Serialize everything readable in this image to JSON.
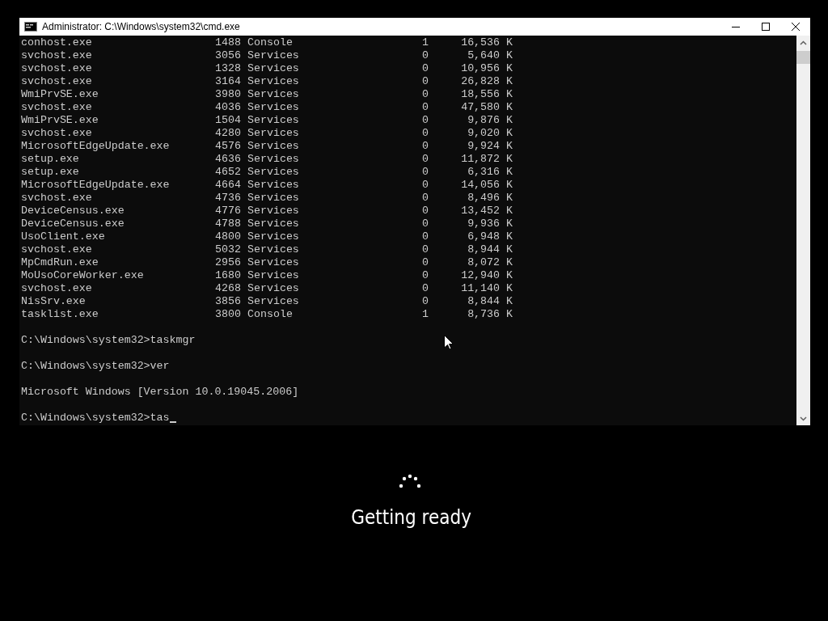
{
  "window": {
    "title": "Administrator: C:\\Windows\\system32\\cmd.exe"
  },
  "processes": [
    {
      "name": "conhost.exe",
      "pid": "1488",
      "session_name": "Console",
      "session": "1",
      "mem": "16,536 K"
    },
    {
      "name": "svchost.exe",
      "pid": "3056",
      "session_name": "Services",
      "session": "0",
      "mem": "5,640 K"
    },
    {
      "name": "svchost.exe",
      "pid": "1328",
      "session_name": "Services",
      "session": "0",
      "mem": "10,956 K"
    },
    {
      "name": "svchost.exe",
      "pid": "3164",
      "session_name": "Services",
      "session": "0",
      "mem": "26,828 K"
    },
    {
      "name": "WmiPrvSE.exe",
      "pid": "3980",
      "session_name": "Services",
      "session": "0",
      "mem": "18,556 K"
    },
    {
      "name": "svchost.exe",
      "pid": "4036",
      "session_name": "Services",
      "session": "0",
      "mem": "47,580 K"
    },
    {
      "name": "WmiPrvSE.exe",
      "pid": "1504",
      "session_name": "Services",
      "session": "0",
      "mem": "9,876 K"
    },
    {
      "name": "svchost.exe",
      "pid": "4280",
      "session_name": "Services",
      "session": "0",
      "mem": "9,020 K"
    },
    {
      "name": "MicrosoftEdgeUpdate.exe",
      "pid": "4576",
      "session_name": "Services",
      "session": "0",
      "mem": "9,924 K"
    },
    {
      "name": "setup.exe",
      "pid": "4636",
      "session_name": "Services",
      "session": "0",
      "mem": "11,872 K"
    },
    {
      "name": "setup.exe",
      "pid": "4652",
      "session_name": "Services",
      "session": "0",
      "mem": "6,316 K"
    },
    {
      "name": "MicrosoftEdgeUpdate.exe",
      "pid": "4664",
      "session_name": "Services",
      "session": "0",
      "mem": "14,056 K"
    },
    {
      "name": "svchost.exe",
      "pid": "4736",
      "session_name": "Services",
      "session": "0",
      "mem": "8,496 K"
    },
    {
      "name": "DeviceCensus.exe",
      "pid": "4776",
      "session_name": "Services",
      "session": "0",
      "mem": "13,452 K"
    },
    {
      "name": "DeviceCensus.exe",
      "pid": "4788",
      "session_name": "Services",
      "session": "0",
      "mem": "9,936 K"
    },
    {
      "name": "UsoClient.exe",
      "pid": "4800",
      "session_name": "Services",
      "session": "0",
      "mem": "6,948 K"
    },
    {
      "name": "svchost.exe",
      "pid": "5032",
      "session_name": "Services",
      "session": "0",
      "mem": "8,944 K"
    },
    {
      "name": "MpCmdRun.exe",
      "pid": "2956",
      "session_name": "Services",
      "session": "0",
      "mem": "8,072 K"
    },
    {
      "name": "MoUsoCoreWorker.exe",
      "pid": "1680",
      "session_name": "Services",
      "session": "0",
      "mem": "12,940 K"
    },
    {
      "name": "svchost.exe",
      "pid": "4268",
      "session_name": "Services",
      "session": "0",
      "mem": "11,140 K"
    },
    {
      "name": "NisSrv.exe",
      "pid": "3856",
      "session_name": "Services",
      "session": "0",
      "mem": "8,844 K"
    },
    {
      "name": "tasklist.exe",
      "pid": "3800",
      "session_name": "Console",
      "session": "1",
      "mem": "8,736 K"
    }
  ],
  "console_lines": [
    {
      "text": "C:\\Windows\\system32>taskmgr",
      "cursor": false
    },
    {
      "text": "C:\\Windows\\system32>ver",
      "cursor": false
    },
    {
      "text": "Microsoft Windows [Version 10.0.19045.2006]",
      "cursor": false
    },
    {
      "text": "C:\\Windows\\system32>tas",
      "cursor": true
    }
  ],
  "status": {
    "text": "Getting ready"
  }
}
